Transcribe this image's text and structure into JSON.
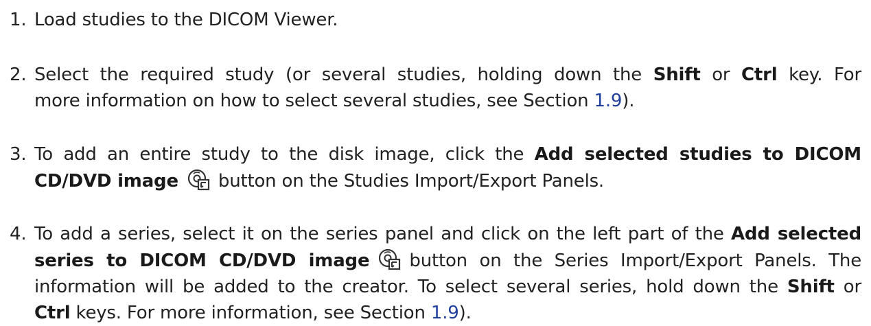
{
  "steps": [
    {
      "number": "1.",
      "lines": [
        {
          "segments": [
            {
              "t": "Load studies to the DICOM Viewer."
            }
          ]
        }
      ]
    },
    {
      "number": "2.",
      "lines": [
        {
          "segments": [
            {
              "t": "Select the required study (or several studies, holding down the "
            },
            {
              "t": "Shift",
              "bold": true
            },
            {
              "t": " or "
            },
            {
              "t": "Ctrl",
              "bold": true
            },
            {
              "t": " key.  For"
            }
          ]
        },
        {
          "segments": [
            {
              "t": "more information on how to select several studies, see Section "
            },
            {
              "t": "1.9",
              "link": true
            },
            {
              "t": ")."
            }
          ]
        }
      ]
    },
    {
      "number": "3.",
      "lines": [
        {
          "segments": [
            {
              "t": "To add an entire study to the disk image, click the "
            },
            {
              "t": "Add selected studies to DICOM",
              "bold": true
            }
          ]
        },
        {
          "segments": [
            {
              "t": "CD/DVD image",
              "bold": true
            },
            {
              "icon": "add-to-cd-dvd-icon"
            },
            {
              "t": "button on the Studies Import/Export Panels."
            }
          ]
        }
      ]
    },
    {
      "number": "4.",
      "lines": [
        {
          "segments": [
            {
              "t": "To add a series, select it on the series panel and click on the left part of the "
            },
            {
              "t": "Add selected",
              "bold": true
            }
          ]
        },
        {
          "segments": [
            {
              "t": "series to DICOM CD/DVD image",
              "bold": true
            },
            {
              "icon": "add-to-cd-dvd-icon"
            },
            {
              "t": "button on the Series Import/Export Panels.  The"
            }
          ]
        },
        {
          "segments": [
            {
              "t": "information will be added to the creator.  To select several series, hold down the "
            },
            {
              "t": "Shift",
              "bold": true
            },
            {
              "t": " or"
            }
          ]
        },
        {
          "segments": [
            {
              "t": "Ctrl",
              "bold": true
            },
            {
              "t": " keys.  For more information, see Section "
            },
            {
              "t": "1.9",
              "link": true
            },
            {
              "t": ")."
            }
          ]
        }
      ]
    }
  ]
}
